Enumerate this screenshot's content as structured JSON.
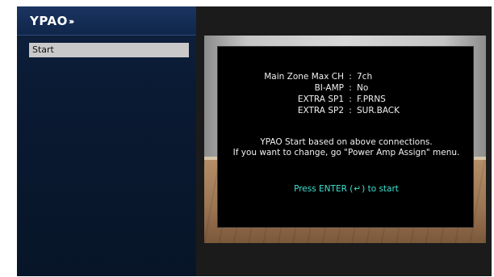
{
  "app": {
    "logo": "YPAO",
    "logo_waves": "›››"
  },
  "sidebar": {
    "items": [
      {
        "label": "Start"
      }
    ]
  },
  "dialog": {
    "connections": [
      {
        "label": "Main Zone Max CH",
        "value": "7ch"
      },
      {
        "label": "BI-AMP",
        "value": "No"
      },
      {
        "label": "EXTRA SP1",
        "value": "F.PRNS"
      },
      {
        "label": "EXTRA SP2",
        "value": "SUR.BACK"
      }
    ],
    "separator": ":",
    "info_line1": "YPAO Start based on above connections.",
    "info_line2": "If you want to change, go \"Power Amp Assign\" menu.",
    "prompt_prefix": "Press ENTER (",
    "prompt_glyph": "↵",
    "prompt_suffix": ") to start"
  },
  "colors": {
    "sidebar_bg": "#0a1a33",
    "menu_highlight": "#c9c9c9",
    "prompt_text": "#3ee0d0",
    "dialog_bg": "#000000"
  }
}
